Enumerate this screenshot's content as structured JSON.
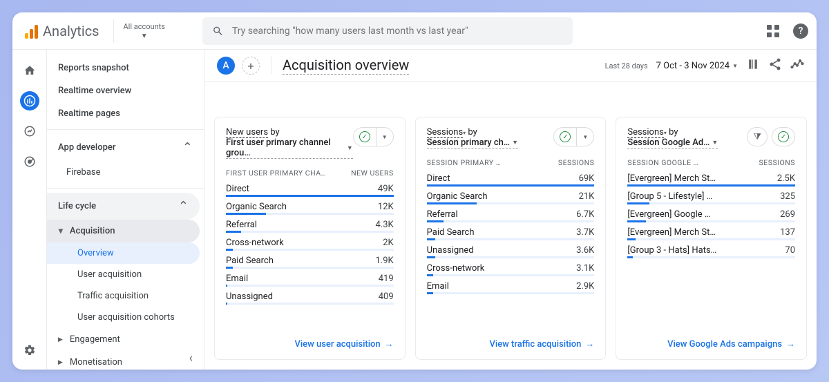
{
  "brand": "Analytics",
  "accountSelector": "All accounts",
  "search": {
    "placeholder": "Try searching \"how many users last month vs last year\""
  },
  "sidebar": {
    "top": [
      "Reports snapshot",
      "Realtime overview",
      "Realtime pages"
    ],
    "appDev": {
      "label": "App developer",
      "items": [
        "Firebase"
      ]
    },
    "lifeCycle": {
      "label": "Life cycle",
      "acquisition": {
        "label": "Acquisition",
        "items": [
          "Overview",
          "User acquisition",
          "Traffic acquisition",
          "User acquisition cohorts"
        ]
      },
      "engagement": "Engagement",
      "monetisation": "Monetisation"
    }
  },
  "page": {
    "avatarLetter": "A",
    "title": "Acquisition overview",
    "dateLabel": "Last 28 days",
    "dateRange": "7 Oct - 3 Nov 2024"
  },
  "cards": [
    {
      "line1a": "New users",
      "line1b": " by",
      "line2": "First user primary channel grou…",
      "colA": "FIRST USER PRIMARY CHA…",
      "colB": "NEW USERS",
      "rows": [
        {
          "label": "Direct",
          "value": "49K",
          "pct": 100
        },
        {
          "label": "Organic Search",
          "value": "12K",
          "pct": 24
        },
        {
          "label": "Referral",
          "value": "4.3K",
          "pct": 9
        },
        {
          "label": "Cross-network",
          "value": "2K",
          "pct": 4
        },
        {
          "label": "Paid Search",
          "value": "1.9K",
          "pct": 4
        },
        {
          "label": "Email",
          "value": "419",
          "pct": 1
        },
        {
          "label": "Unassigned",
          "value": "409",
          "pct": 1
        }
      ],
      "footer": "View user acquisition",
      "filter": false
    },
    {
      "line1a": "Sessions",
      "line1b": " by",
      "line2": "Session primary ch…",
      "colA": "SESSION PRIMARY …",
      "colB": "SESSIONS",
      "rows": [
        {
          "label": "Direct",
          "value": "69K",
          "pct": 100
        },
        {
          "label": "Organic Search",
          "value": "21K",
          "pct": 30
        },
        {
          "label": "Referral",
          "value": "6.7K",
          "pct": 10
        },
        {
          "label": "Paid Search",
          "value": "3.7K",
          "pct": 5
        },
        {
          "label": "Unassigned",
          "value": "3.6K",
          "pct": 5
        },
        {
          "label": "Cross-network",
          "value": "3.1K",
          "pct": 4
        },
        {
          "label": "Email",
          "value": "2.9K",
          "pct": 4
        }
      ],
      "footer": "View traffic acquisition",
      "filter": false
    },
    {
      "line1a": "Sessions",
      "line1b": " by",
      "line2": "Session Google Ad…",
      "colA": "SESSION GOOGLE …",
      "colB": "SESSIONS",
      "rows": [
        {
          "label": "[Evergreen] Merch St…",
          "value": "2.5K",
          "pct": 100
        },
        {
          "label": "[Group 5 - Lifestyle] …",
          "value": "325",
          "pct": 13
        },
        {
          "label": "[Evergreen] Google …",
          "value": "269",
          "pct": 11
        },
        {
          "label": "[Evergreen] Merch St…",
          "value": "137",
          "pct": 5
        },
        {
          "label": "[Group 3 - Hats] Hats…",
          "value": "70",
          "pct": 3
        }
      ],
      "footer": "View Google Ads campaigns",
      "filter": true
    }
  ],
  "chart_data": [
    {
      "type": "bar",
      "title": "New users by First user primary channel group",
      "xlabel": "First user primary channel group",
      "ylabel": "New users",
      "categories": [
        "Direct",
        "Organic Search",
        "Referral",
        "Cross-network",
        "Paid Search",
        "Email",
        "Unassigned"
      ],
      "values": [
        49000,
        12000,
        4300,
        2000,
        1900,
        419,
        409
      ]
    },
    {
      "type": "bar",
      "title": "Sessions by Session primary channel group",
      "xlabel": "Session primary channel group",
      "ylabel": "Sessions",
      "categories": [
        "Direct",
        "Organic Search",
        "Referral",
        "Paid Search",
        "Unassigned",
        "Cross-network",
        "Email"
      ],
      "values": [
        69000,
        21000,
        6700,
        3700,
        3600,
        3100,
        2900
      ]
    },
    {
      "type": "bar",
      "title": "Sessions by Session Google Ads campaign",
      "xlabel": "Session Google Ads campaign",
      "ylabel": "Sessions",
      "categories": [
        "[Evergreen] Merch St…",
        "[Group 5 - Lifestyle] …",
        "[Evergreen] Google …",
        "[Evergreen] Merch St…",
        "[Group 3 - Hats] Hats…"
      ],
      "values": [
        2500,
        325,
        269,
        137,
        70
      ]
    }
  ]
}
